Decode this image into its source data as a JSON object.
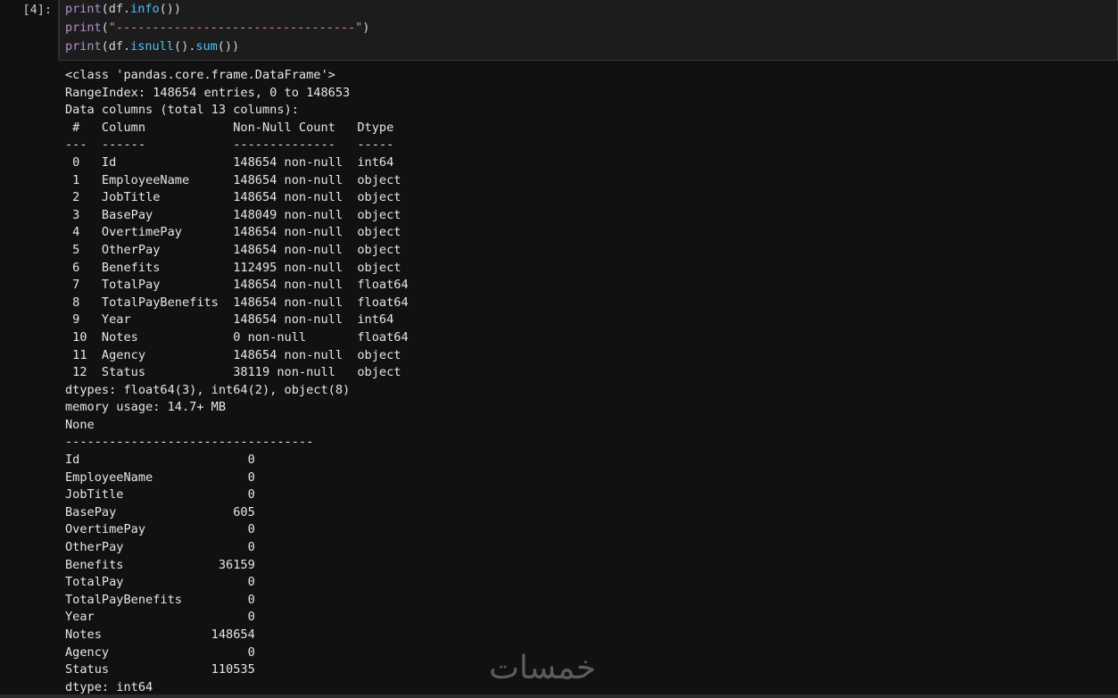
{
  "cell": {
    "prompt": "[4]:",
    "code_lines": [
      [
        {
          "t": "print",
          "c": "bi"
        },
        {
          "t": "(df.",
          "c": "plain"
        },
        {
          "t": "info",
          "c": "attr"
        },
        {
          "t": "())",
          "c": "plain"
        }
      ],
      [
        {
          "t": "print",
          "c": "bi"
        },
        {
          "t": "(",
          "c": "plain"
        },
        {
          "t": "\"---------------------------------\"",
          "c": "str"
        },
        {
          "t": ")",
          "c": "plain"
        }
      ],
      [
        {
          "t": "print",
          "c": "bi"
        },
        {
          "t": "(df.",
          "c": "plain"
        },
        {
          "t": "isnull",
          "c": "attr"
        },
        {
          "t": "().",
          "c": "plain"
        },
        {
          "t": "sum",
          "c": "attr"
        },
        {
          "t": "())",
          "c": "plain"
        }
      ]
    ]
  },
  "output_lines": [
    "<class 'pandas.core.frame.DataFrame'>",
    "RangeIndex: 148654 entries, 0 to 148653",
    "Data columns (total 13 columns):",
    " #   Column            Non-Null Count   Dtype  ",
    "---  ------            --------------   -----  ",
    " 0   Id                148654 non-null  int64  ",
    " 1   EmployeeName      148654 non-null  object ",
    " 2   JobTitle          148654 non-null  object ",
    " 3   BasePay           148049 non-null  object ",
    " 4   OvertimePay       148654 non-null  object ",
    " 5   OtherPay          148654 non-null  object ",
    " 6   Benefits          112495 non-null  object ",
    " 7   TotalPay          148654 non-null  float64",
    " 8   TotalPayBenefits  148654 non-null  float64",
    " 9   Year              148654 non-null  int64  ",
    " 10  Notes             0 non-null       float64",
    " 11  Agency            148654 non-null  object ",
    " 12  Status            38119 non-null   object ",
    "dtypes: float64(3), int64(2), object(8)",
    "memory usage: 14.7+ MB",
    "None",
    "----------------------------------",
    "Id                       0",
    "EmployeeName             0",
    "JobTitle                 0",
    "BasePay                605",
    "OvertimePay              0",
    "OtherPay                 0",
    "Benefits             36159",
    "TotalPay                 0",
    "TotalPayBenefits         0",
    "Year                     0",
    "Notes               148654",
    "Agency                   0",
    "Status              110535",
    "dtype: int64"
  ],
  "watermark": "خمسات"
}
